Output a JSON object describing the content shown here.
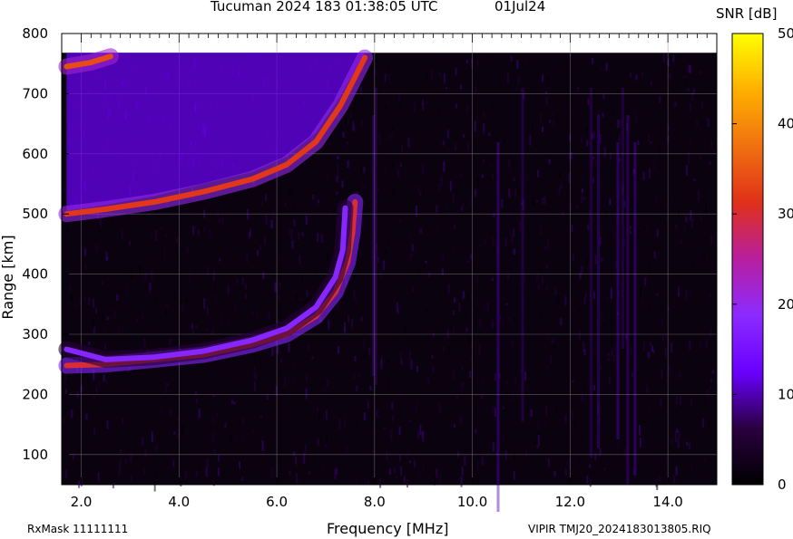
{
  "header": {
    "title": "Tucuman 2024 183 01:38:05 UTC",
    "date": "01Jul24"
  },
  "colorbar": {
    "label": "SNR [dB]",
    "ticks": [
      "50",
      "40",
      "30",
      "20",
      "10",
      "0"
    ],
    "range": [
      0,
      50
    ],
    "colors": [
      "#000000",
      "#2a0040",
      "#6a00ff",
      "#8b2bff",
      "#b81fa0",
      "#e0301a",
      "#f07010",
      "#ffb000",
      "#ffff00"
    ]
  },
  "footer": {
    "rxmask": "RxMask 11111111",
    "file": "VIPIR  TMJ20_2024183013805.RIQ"
  },
  "chart_data": {
    "type": "heatmap",
    "title": "Tucuman 2024 183 01:38:05 UTC",
    "xlabel": "Frequency [MHz]",
    "ylabel": "Range [km]",
    "xlim": [
      1.6,
      15.0
    ],
    "ylim": [
      50,
      800
    ],
    "xticks": [
      "2.0",
      "4.0",
      "6.0",
      "8.0",
      "10.0",
      "12.0",
      "14.0"
    ],
    "yticks": [
      "100",
      "200",
      "300",
      "400",
      "500",
      "600",
      "700",
      "800"
    ],
    "grid": true,
    "traces": [
      {
        "name": "",
        "snr": 30,
        "points": [
          [
            1.7,
            248
          ],
          [
            2.5,
            250
          ],
          [
            3.5,
            258
          ],
          [
            4.5,
            266
          ],
          [
            5.5,
            283
          ],
          [
            6.2,
            300
          ],
          [
            6.8,
            330
          ],
          [
            7.2,
            370
          ],
          [
            7.45,
            420
          ],
          [
            7.55,
            470
          ],
          [
            7.6,
            520
          ]
        ]
      },
      {
        "name": "",
        "snr": 18,
        "points": [
          [
            1.7,
            275
          ],
          [
            2.5,
            258
          ],
          [
            3.5,
            262
          ],
          [
            4.5,
            272
          ],
          [
            5.5,
            290
          ],
          [
            6.2,
            310
          ],
          [
            6.8,
            345
          ],
          [
            7.2,
            395
          ],
          [
            7.35,
            440
          ],
          [
            7.4,
            510
          ]
        ]
      },
      {
        "name": "",
        "snr": 32,
        "points": [
          [
            1.7,
            500
          ],
          [
            2.5,
            508
          ],
          [
            3.5,
            520
          ],
          [
            4.5,
            537
          ],
          [
            5.5,
            558
          ],
          [
            6.2,
            582
          ],
          [
            6.8,
            620
          ],
          [
            7.3,
            680
          ],
          [
            7.8,
            760
          ]
        ]
      },
      {
        "name": "",
        "snr": 34,
        "points": [
          [
            1.7,
            745
          ],
          [
            2.2,
            752
          ],
          [
            2.6,
            762
          ]
        ]
      }
    ]
  }
}
